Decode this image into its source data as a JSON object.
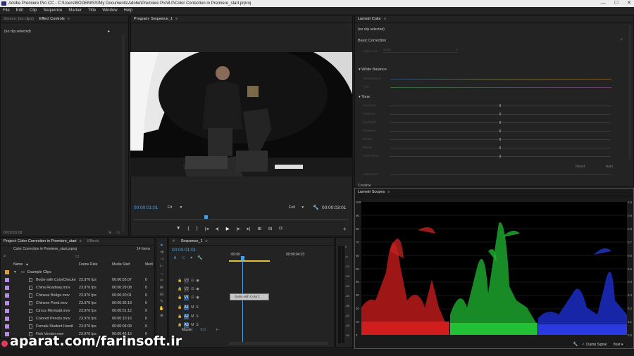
{
  "window": {
    "title": "Adobe Premiere Pro CC - C:\\Users\\BODEMISS\\My Documents\\Adobe\\Premiere Pro\\8.0\\Color Correction in Premiere_start.prproj",
    "minimize": "—",
    "maximize": "☐",
    "close": "✕"
  },
  "menu": [
    "File",
    "Edit",
    "Clip",
    "Sequence",
    "Marker",
    "Title",
    "Window",
    "Help"
  ],
  "source_panel": {
    "tab_source": "Source: (no clips)",
    "tab_effect_controls": "Effect Controls",
    "no_clip": "(no clip selected)",
    "timecode": "00:00:01:00"
  },
  "program": {
    "tab": "Program: Sequence_1",
    "timecode": "00:00:01:01",
    "fit": "Fit",
    "quality": "Full",
    "duration": "00:00:03:01"
  },
  "lumetri_color": {
    "tab": "Lumetri Color",
    "no_clip": "(no clip selected)",
    "basic_correction": "Basic Correction",
    "input_lut_label": "Input LUT",
    "input_lut_value": "None",
    "white_balance": "White Balance",
    "temperature": "Temperature",
    "tint": "Tint",
    "tone": "Tone",
    "tone_rows": [
      "Exposure",
      "Contrast",
      "Highlights",
      "Shadows",
      "Whites",
      "Blacks",
      "HDR White"
    ],
    "saturation": "Saturation",
    "reset": "Reset",
    "auto": "Auto",
    "creative": "Creative"
  },
  "lumetri_scopes": {
    "tab": "Lumetri Scopes",
    "left_axis": [
      "100",
      "90",
      "80",
      "70",
      "60",
      "50",
      "40",
      "30",
      "20",
      "10",
      "0"
    ],
    "right_axis": [
      "1.0",
      "0.9",
      "0.8",
      "0.7",
      "0.6",
      "0.5",
      "0.4",
      "0.3",
      "0.2",
      "0.1",
      "0.0"
    ],
    "clamp_signal": "Clamp Signal",
    "float": "float"
  },
  "project": {
    "tab": "Project: Color Correction in Premiere_start",
    "tab_effects": "Effects",
    "file": "Color Correction in Premiere_start.prproj",
    "items_count": "14 Items",
    "col_name": "Name",
    "col_frame_rate": "Frame Rate",
    "col_media_start": "Media Start",
    "col_media_end": "Medi",
    "folder": "Example Clips",
    "clips": [
      {
        "name": "Bodie with ColorChecke",
        "rate": "23.976 fps",
        "start": "00:00:55:07",
        "end": "0",
        "color": "#b48ee0"
      },
      {
        "name": "China Roadway.mov",
        "rate": "23.976 fps",
        "start": "00:00:29:08",
        "end": "0",
        "color": "#b48ee0"
      },
      {
        "name": "Chinese Bridge.mov",
        "rate": "23.976 fps",
        "start": "00:00:20:01",
        "end": "0",
        "color": "#b48ee0"
      },
      {
        "name": "Chinese Pond.mov",
        "rate": "23.976 fps",
        "start": "00:00:35:18",
        "end": "0",
        "color": "#b48ee0"
      },
      {
        "name": "Circus Mermaid.mov",
        "rate": "23.976 fps",
        "start": "00:00:51:12",
        "end": "0",
        "color": "#b48ee0"
      },
      {
        "name": "Colored Pencils.mov",
        "rate": "23.976 fps",
        "start": "00:00:10:16",
        "end": "0",
        "color": "#b48ee0"
      },
      {
        "name": "Female Student Hoodi",
        "rate": "23.976 fps",
        "start": "00:00:04:09",
        "end": "0",
        "color": "#b48ee0"
      },
      {
        "name": "Fish Vendor.mov",
        "rate": "23.976 fps",
        "start": "00:00:46:15",
        "end": "0",
        "color": "#b48ee0"
      }
    ]
  },
  "sequence": {
    "tab": "Sequence_1",
    "timecode": "00:00:01:01",
    "ruler_start": ":00:00",
    "ruler_end": "00:00:04:23",
    "tracks": [
      "V3",
      "V2",
      "V1",
      "A1",
      "A2",
      "A3"
    ],
    "master": "Master",
    "master_value": "0.0",
    "clip_label": "Bodie with ColorC"
  },
  "meter_scale": [
    "0",
    "-6",
    "-12",
    "-18",
    "-24",
    "-30",
    "-36",
    "-42",
    "-48",
    "-54"
  ],
  "watermark": "aparat.com/farinsoft.ir"
}
